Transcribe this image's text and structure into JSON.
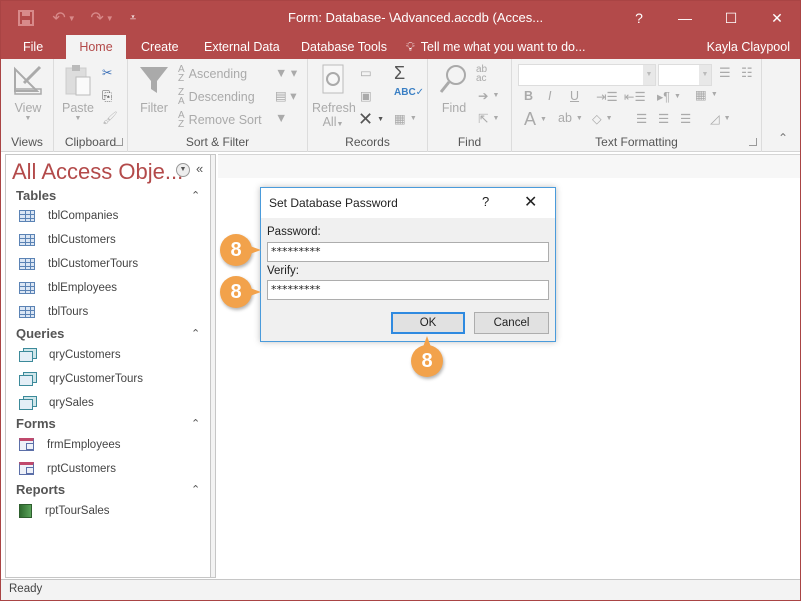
{
  "window": {
    "title": "Form: Database- \\Advanced.accdb (Acces...",
    "help": "?",
    "minimize": "—",
    "maximize": "☐",
    "close": "✕"
  },
  "qat": {
    "save_icon": "save-icon",
    "undo_icon": "undo-icon",
    "redo_icon": "redo-icon",
    "customize_icon": "customize-qat-icon"
  },
  "tabs": [
    {
      "label": "File",
      "active": false
    },
    {
      "label": "Home",
      "active": true
    },
    {
      "label": "Create",
      "active": false
    },
    {
      "label": "External Data",
      "active": false
    },
    {
      "label": "Database Tools",
      "active": false
    }
  ],
  "tell_me": "Tell me what you want to do...",
  "user": "Kayla Claypool",
  "ribbon": {
    "views": {
      "label": "Views",
      "view": "View"
    },
    "clipboard": {
      "label": "Clipboard",
      "paste": "Paste"
    },
    "sort_filter": {
      "label": "Sort & Filter",
      "filter": "Filter",
      "ascending": "Ascending",
      "descending": "Descending",
      "remove_sort": "Remove Sort"
    },
    "records": {
      "label": "Records",
      "refresh": "Refresh",
      "refresh_all": "All"
    },
    "find": {
      "label": "Find",
      "find": "Find"
    },
    "text_formatting": {
      "label": "Text Formatting",
      "bold": "B",
      "italic": "I",
      "underline": "U",
      "font_color": "A"
    }
  },
  "nav": {
    "title": "All Access Obje...",
    "sections": [
      {
        "name": "Tables",
        "items": [
          "tblCompanies",
          "tblCustomers",
          "tblCustomerTours",
          "tblEmployees",
          "tblTours"
        ]
      },
      {
        "name": "Queries",
        "items": [
          "qryCustomers",
          "qryCustomerTours",
          "qrySales"
        ]
      },
      {
        "name": "Forms",
        "items": [
          "frmEmployees",
          "rptCustomers"
        ]
      },
      {
        "name": "Reports",
        "items": [
          "rptTourSales"
        ]
      }
    ]
  },
  "dialog": {
    "title": "Set Database Password",
    "help": "?",
    "close": "✕",
    "password_label": "Password:",
    "password_value": "*********",
    "verify_label": "Verify:",
    "verify_value": "*********",
    "ok": "OK",
    "cancel": "Cancel"
  },
  "callouts": {
    "step": "8"
  },
  "status": "Ready",
  "colors": {
    "accent": "#b34a4a",
    "callout": "#f2a24b",
    "dialog_border": "#4a9bdb"
  }
}
